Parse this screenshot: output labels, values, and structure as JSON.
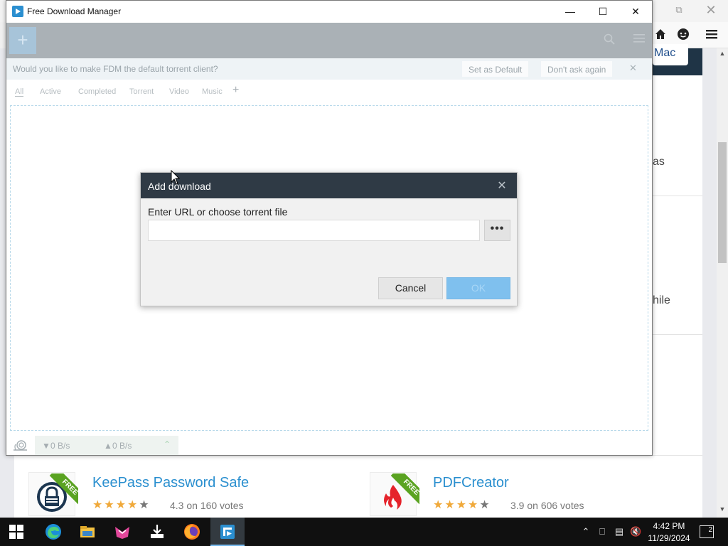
{
  "browser": {
    "mac_label": "Mac",
    "snippets": [
      "as",
      "hile"
    ],
    "apps": [
      {
        "name": "KeePass Password Safe",
        "rating_text": "4.3 on 160 votes",
        "rating": 4.3,
        "badge": "FREE"
      },
      {
        "name": "PDFCreator",
        "rating_text": "3.9 on 606 votes",
        "rating": 3.9,
        "badge": "FREE"
      }
    ]
  },
  "fdm": {
    "title": "Free Download Manager",
    "banner": {
      "text": "Would you like to make FDM the default torrent client?",
      "set_default": "Set as Default",
      "dont_ask": "Don't ask again"
    },
    "tabs": [
      "All",
      "Active",
      "Completed",
      "Torrent",
      "Video",
      "Music"
    ],
    "status": {
      "download_speed": "0 B/s",
      "upload_speed": "0 B/s"
    }
  },
  "dialog": {
    "title": "Add download",
    "label": "Enter URL or choose torrent file",
    "input_value": "",
    "browse_label": "•••",
    "cancel_label": "Cancel",
    "ok_label": "OK"
  },
  "taskbar": {
    "time": "4:42 PM",
    "date": "11/29/2024",
    "notification_count": "2",
    "apps": [
      "edge-icon",
      "file-explorer-icon",
      "app-icon",
      "installer-icon",
      "firefox-icon",
      "fdm-icon"
    ]
  },
  "colors": {
    "fdm_accent": "#2b8fd0",
    "dialog_header": "#2f3a45",
    "ok_button": "#7fc0ee",
    "link_blue": "#2a8fcf",
    "star_orange": "#f0a93a",
    "free_green": "#5aa321"
  }
}
